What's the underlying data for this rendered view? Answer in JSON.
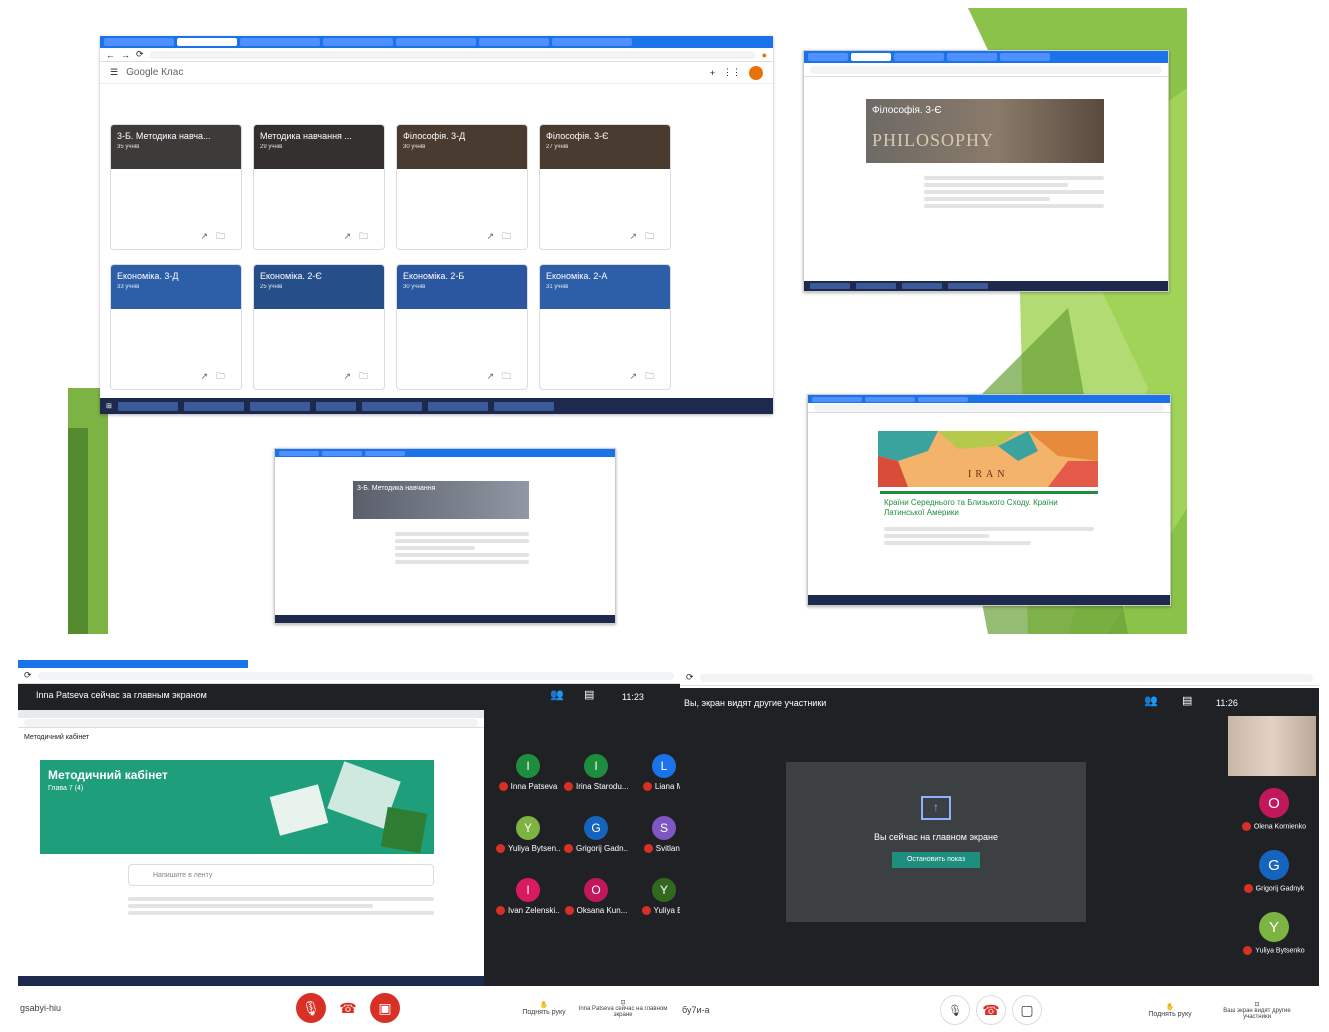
{
  "top_left": {
    "brand": "Google Клас",
    "cards": [
      {
        "title": "3-Б. Методика навча...",
        "sub": "35 учнів",
        "color": "#3d3a3a"
      },
      {
        "title": "Методика навчання ...",
        "sub": "29 учнів",
        "color": "#33302f"
      },
      {
        "title": "Філософія. 3-Д",
        "sub": "30 учнів",
        "color": "#4a3b30"
      },
      {
        "title": "Філософія. 3-Є",
        "sub": "27 учнів",
        "color": "#4a3b30"
      },
      {
        "title": "Економіка. 3-Д",
        "sub": "33 учнів",
        "color": "#2c5fa8"
      },
      {
        "title": "Економіка. 2-Є",
        "sub": "25 учнів",
        "color": "#264f8a"
      },
      {
        "title": "Економіка. 2-Б",
        "sub": "30 учнів",
        "color": "#2a57a0"
      },
      {
        "title": "Економіка. 2-А",
        "sub": "31 учнів",
        "color": "#2c5fa8"
      }
    ]
  },
  "top_right": {
    "title": "Філософія. 3-Є",
    "banner": "PHILOSOPHY"
  },
  "center": {
    "title": "3-Б. Методика навчання"
  },
  "right_mid": {
    "map_label": "IRAN",
    "heading": "Країни Середнього та Близького Сходу. Країни Латинської Америки"
  },
  "meet_left": {
    "presenter_banner": "Inna Patseva сейчас за главным экраном",
    "time": "11:23",
    "class_title": "Методичний кабінет",
    "class_sub": "Глава 7 (4)",
    "post_placeholder": "Напишите в ленту",
    "tiles": [
      {
        "letter": "I",
        "name": "Inna Patseva",
        "color": "#1e8e3e"
      },
      {
        "letter": "I",
        "name": "Irina Starodu...",
        "color": "#1e8e3e"
      },
      {
        "letter": "L",
        "name": "Liana Mi",
        "color": "#1a73e8"
      },
      {
        "letter": "Y",
        "name": "Yuliya Bytsen...",
        "color": "#7cb342"
      },
      {
        "letter": "G",
        "name": "Grigorij Gadn...",
        "color": "#1565c0"
      },
      {
        "letter": "S",
        "name": "Svitlana",
        "color": "#7e57c2"
      },
      {
        "letter": "I",
        "name": "Ivan Zelenski...",
        "color": "#d81b60"
      },
      {
        "letter": "O",
        "name": "Oksana Kun...",
        "color": "#c2185b"
      },
      {
        "letter": "Y",
        "name": "Yuliya By",
        "color": "#33691e"
      }
    ],
    "footer_name": "gsabyi-hiu",
    "raise_hand": "Поднять руку",
    "stop_label": "Inna Patseva сейчас на главном экране"
  },
  "meet_right": {
    "banner": "Вы, экран видят другие участники",
    "time": "11:26",
    "presenting_text": "Вы сейчас на главном экране",
    "stop_button": "Остановить показ",
    "participants": [
      {
        "letter": "O",
        "name": "Olena Kornienko",
        "color": "#c2185b"
      },
      {
        "letter": "G",
        "name": "Grigorij Gadnyk",
        "color": "#1565c0"
      },
      {
        "letter": "Y",
        "name": "Yuliya Bytsenko",
        "color": "#7cb342"
      }
    ],
    "footer_name": "бу7и-а",
    "raise_hand": "Поднять руку",
    "present_label": "Ваш экран видят другие участники"
  }
}
